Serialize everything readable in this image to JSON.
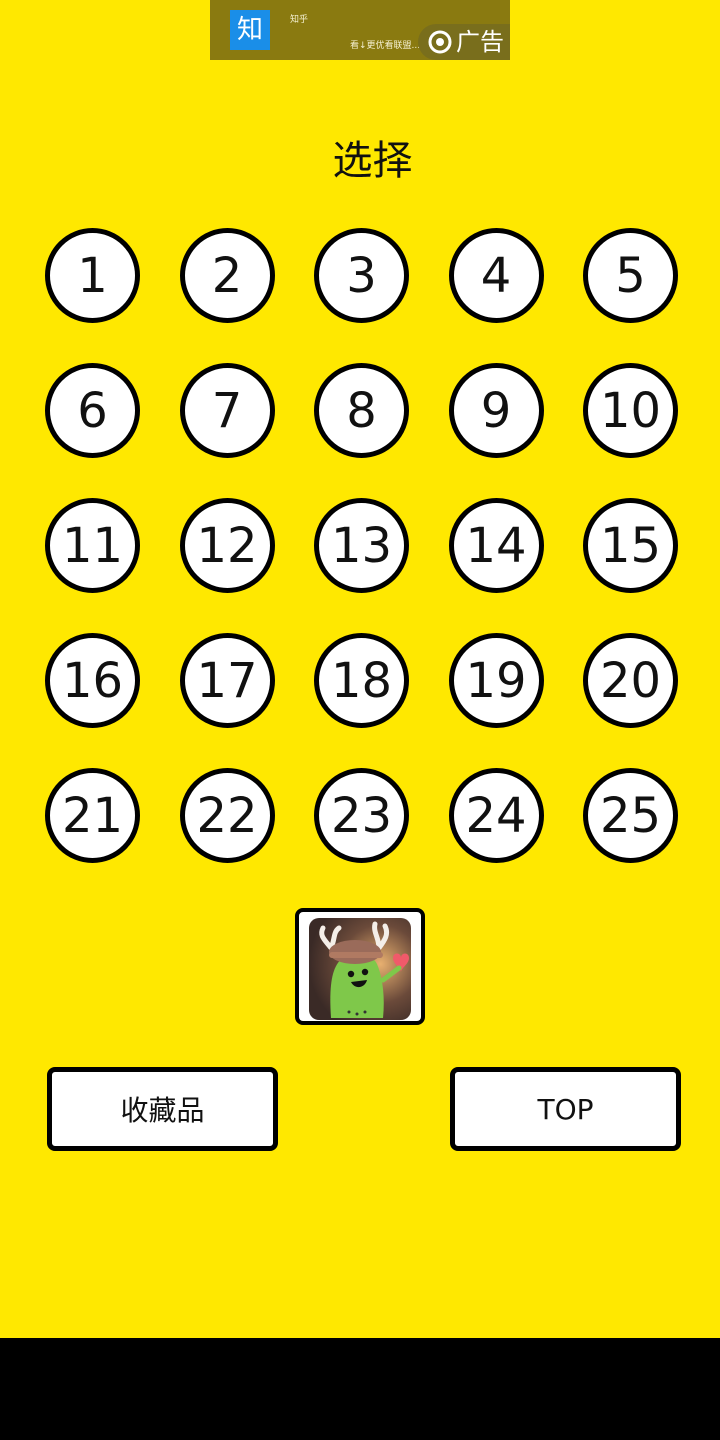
{
  "ad": {
    "logo_text": "知",
    "app_name": "知乎",
    "description": "看↓更优看联盟...",
    "badge_label": "广告"
  },
  "title": "选择",
  "levels": [
    "1",
    "2",
    "3",
    "4",
    "5",
    "6",
    "7",
    "8",
    "9",
    "10",
    "11",
    "12",
    "13",
    "14",
    "15",
    "16",
    "17",
    "18",
    "19",
    "20",
    "21",
    "22",
    "23",
    "24",
    "25"
  ],
  "buttons": {
    "collection_label": "收藏品",
    "top_label": "TOP"
  },
  "colors": {
    "background": "#FFE800",
    "ad_background": "#8a7a10",
    "button_fill": "#ffffff",
    "button_border": "#000000"
  }
}
